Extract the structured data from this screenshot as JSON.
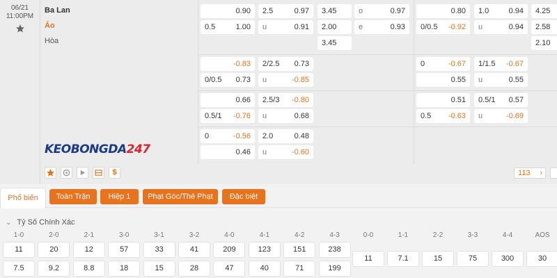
{
  "match": {
    "date": "06/21",
    "time": "11:00PM",
    "home": "Ba Lan",
    "away": "Áo",
    "draw": "Hòa",
    "logo_part1": "KEOBONGDA",
    "logo_part2": "247"
  },
  "block1": {
    "r1": {
      "ah_val": "0.90",
      "ou_line": "2.5",
      "ou_val": "0.97",
      "x12": "3.45",
      "oe_lbl": "o",
      "oe_val": "0.97",
      "h1_ah_val": "0.80",
      "h1_ou_line": "1.0",
      "h1_ou_val": "0.94",
      "h1_x12": "4.25"
    },
    "r2": {
      "ah_line": "0.5",
      "ah_val": "1.00",
      "ou_lbl": "u",
      "ou_val": "0.91",
      "x12": "2.00",
      "oe_lbl": "e",
      "oe_val": "0.93",
      "h1_ah_line": "0/0.5",
      "h1_ah_val": "-0.92",
      "h1_ou_lbl": "u",
      "h1_ou_val": "0.94",
      "h1_x12": "2.58"
    },
    "r3": {
      "x12": "3.45",
      "h1_x12": "2.10"
    }
  },
  "block2": {
    "r1": {
      "ah_val": "-0.83",
      "ou_line": "2/2.5",
      "ou_val": "0.73",
      "h1_ah_line": "0",
      "h1_ah_val": "-0.67",
      "h1_ou_line": "1/1.5",
      "h1_ou_val": "-0.67"
    },
    "r2": {
      "ah_line": "0/0.5",
      "ah_val": "0.73",
      "ou_lbl": "u",
      "ou_val": "-0.85",
      "h1_ah_val": "0.55",
      "h1_ou_lbl": "u",
      "h1_ou_val": "0.55"
    }
  },
  "block3": {
    "r1": {
      "ah_val": "0.66",
      "ou_line": "2.5/3",
      "ou_val": "-0.80",
      "h1_ah_val": "0.51",
      "h1_ou_line": "0.5/1",
      "h1_ou_val": "0.57"
    },
    "r2": {
      "ah_line": "0.5/1",
      "ah_val": "-0.76",
      "ou_lbl": "u",
      "ou_val": "0.68",
      "h1_ah_line": "0.5",
      "h1_ah_val": "-0.63",
      "h1_ou_lbl": "u",
      "h1_ou_val": "-0.69"
    }
  },
  "block4": {
    "r1": {
      "ah_line": "0",
      "ah_val": "-0.56",
      "ou_line": "2.0",
      "ou_val": "0.48"
    },
    "r2": {
      "ah_val": "0.46",
      "ou_lbl": "u",
      "ou_val": "-0.60"
    }
  },
  "actions": {
    "more_count": "113",
    "dollar": "$"
  },
  "tabs": {
    "active": "Phổ biến",
    "items": [
      "Toàn Trận",
      "Hiệp 1",
      "Phạt Góc/Thẻ Phạt",
      "Đặc biệt"
    ]
  },
  "correct_score": {
    "title": "Tỷ Số Chính Xác",
    "home_headers": [
      "1-0",
      "2-0",
      "2-1",
      "3-0",
      "3-1",
      "3-2",
      "4-0",
      "4-1",
      "4-2",
      "4-3"
    ],
    "home_odds": [
      "11",
      "20",
      "12",
      "57",
      "33",
      "41",
      "209",
      "123",
      "151",
      "238"
    ],
    "away_odds": [
      "7.5",
      "9.2",
      "8.8",
      "18",
      "15",
      "28",
      "47",
      "40",
      "71",
      "199"
    ],
    "draw_headers": [
      "0-0",
      "1-1",
      "2-2",
      "3-3",
      "4-4",
      "AOS"
    ],
    "draw_odds": [
      "11",
      "7.1",
      "15",
      "75",
      "300",
      "30"
    ]
  },
  "colors": {
    "accent": "#e8731c",
    "negative": "#e8731c",
    "brand_blue": "#1a3a8a",
    "brand_red": "#d8262e"
  }
}
